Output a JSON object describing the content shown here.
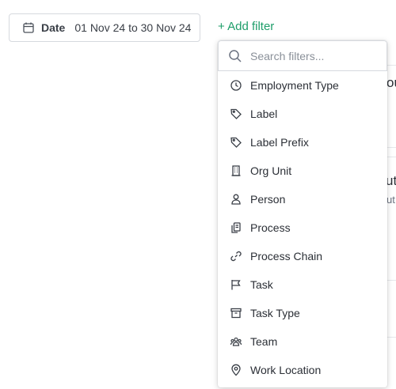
{
  "date_filter": {
    "label": "Date",
    "range": "01 Nov 24 to 30 Nov 24"
  },
  "add_filter": {
    "label": "+ Add filter"
  },
  "dropdown": {
    "search_placeholder": "Search filters...",
    "options": [
      {
        "label": "Employment Type",
        "icon": "clock-icon"
      },
      {
        "label": "Label",
        "icon": "tag-icon"
      },
      {
        "label": "Label Prefix",
        "icon": "tag-icon"
      },
      {
        "label": "Org Unit",
        "icon": "building-icon"
      },
      {
        "label": "Person",
        "icon": "person-icon"
      },
      {
        "label": "Process",
        "icon": "process-icon"
      },
      {
        "label": "Process Chain",
        "icon": "link-icon"
      },
      {
        "label": "Task",
        "icon": "flag-icon"
      },
      {
        "label": "Task Type",
        "icon": "archive-icon"
      },
      {
        "label": "Team",
        "icon": "team-icon"
      },
      {
        "label": "Work Location",
        "icon": "location-pin-icon"
      }
    ]
  },
  "background": {
    "fragment_1": "ou",
    "fragment_2": "ut",
    "fragment_3": "ut"
  },
  "colors": {
    "accent": "#1e9e6a",
    "border": "#d6d9de",
    "text": "#2b2f36"
  }
}
